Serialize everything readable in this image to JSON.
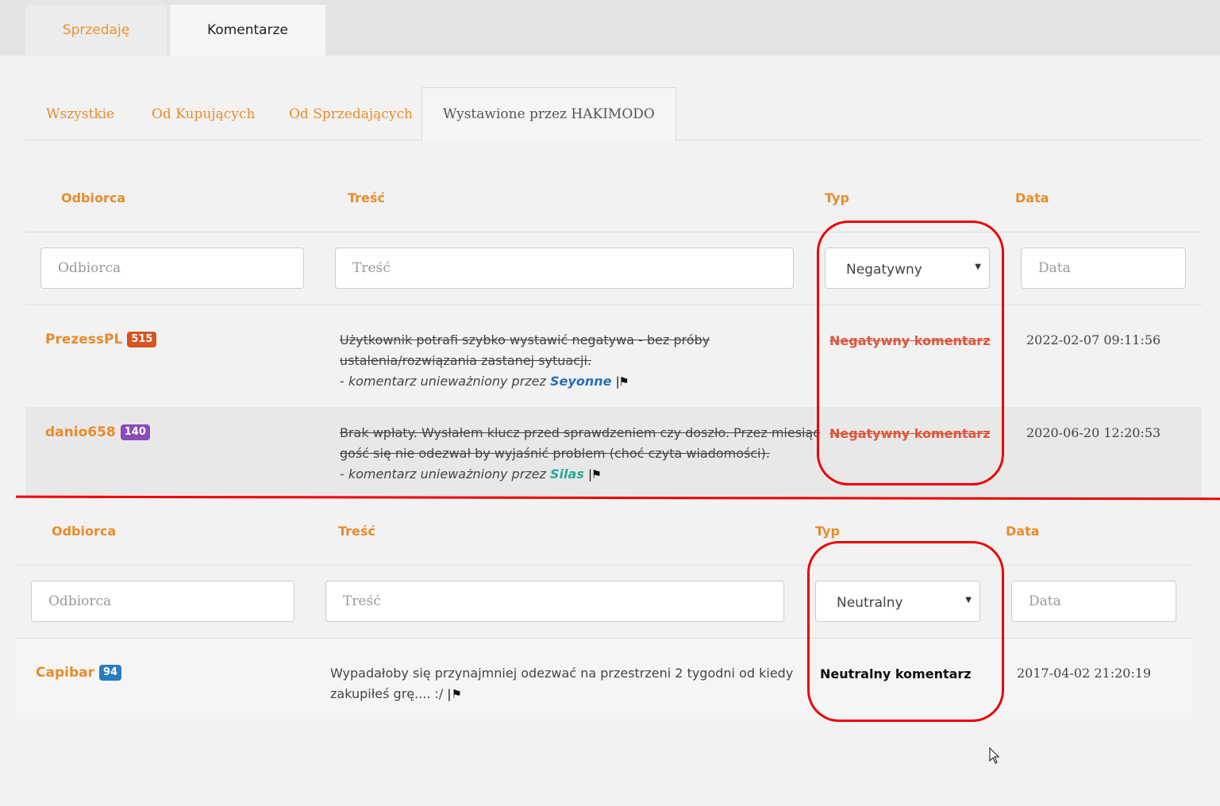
{
  "top_tabs": [
    {
      "label": "Sprzedaję"
    },
    {
      "label": "Komentarze"
    }
  ],
  "sub_tabs": [
    {
      "label": "Wszystkie"
    },
    {
      "label": "Od Kupujących"
    },
    {
      "label": "Od Sprzedających"
    },
    {
      "label": "Wystawione przez HAKIMODO"
    }
  ],
  "table1": {
    "headers": {
      "recipient": "Odbiorca",
      "content": "Treść",
      "type": "Typ",
      "date": "Data"
    },
    "filters": {
      "recipient_placeholder": "Odbiorca",
      "content_placeholder": "Treść",
      "type_value": "Negatywny",
      "date_placeholder": "Data"
    },
    "rows": [
      {
        "user": "PrezessPL",
        "badge": "515",
        "badge_color": "#d9531e",
        "text_line1": "Użytkownik potrafi szybko wystawić negatywa - bez próby",
        "text_line2": "ustalenia/rozwiązania zastanej sytuacji.",
        "note_prefix": "- komentarz unieważniony przez",
        "note_user": "Seyonne",
        "note_user_color": "#2a6fb5",
        "type": "Negatywny komentarz",
        "date": "2022-02-07 09:11:56"
      },
      {
        "user": "danio658",
        "badge": "140",
        "badge_color": "#8a4bb8",
        "text_line1": "Brak wpłaty. Wysłałem klucz przed sprawdzeniem czy doszło. Przez miesiąc",
        "text_line2": "gość się nie odezwał by wyjaśnić problem (choć czyta wiadomości).",
        "note_prefix": "- komentarz unieważniony przez",
        "note_user": "Silas",
        "note_user_color": "#2aa79a",
        "type": "Negatywny komentarz",
        "date": "2020-06-20 12:20:53"
      }
    ]
  },
  "table2": {
    "headers": {
      "recipient": "Odbiorca",
      "content": "Treść",
      "type": "Typ",
      "date": "Data"
    },
    "filters": {
      "recipient_placeholder": "Odbiorca",
      "content_placeholder": "Treść",
      "type_value": "Neutralny",
      "date_placeholder": "Data"
    },
    "rows": [
      {
        "user": "Capibar",
        "badge": "94",
        "badge_color": "#2a7cc0",
        "text_line1": "Wypadałoby się przynajmniej odezwać na przestrzeni 2 tygodni od kiedy",
        "text_line2": "zakupiłeś grę.... :/",
        "type": "Neutralny komentarz",
        "date": "2017-04-02 21:20:19"
      }
    ]
  },
  "icons": {
    "flag": "flag-icon",
    "caret": "caret-down-icon",
    "cursor": "mouse-cursor-icon"
  },
  "colors": {
    "accent": "#e98b2b",
    "annotation": "#e00000"
  }
}
